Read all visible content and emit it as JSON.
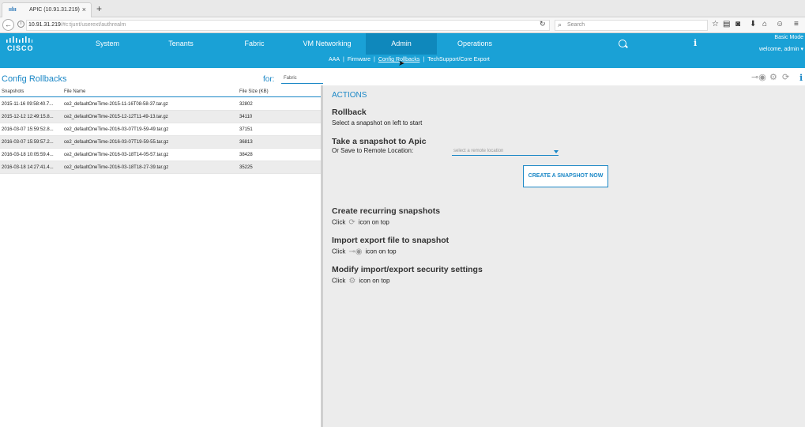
{
  "browser": {
    "tab_favicon": "ıılıı",
    "tab_title": "APIC (10.91.31.219)",
    "tab_close": "×",
    "new_tab": "+",
    "url_host": "10.91.31.219",
    "url_path": "/#c:tjunt/userext/authrealm",
    "search_placeholder": "Search"
  },
  "header": {
    "logo_text": "CISCO",
    "menu": [
      "System",
      "Tenants",
      "Fabric",
      "VM Networking",
      "Admin",
      "Operations"
    ],
    "active_menu": "Admin",
    "mode": "Basic Mode",
    "welcome": "welcome, admin ▾",
    "subnav": [
      "AAA",
      "Firmware",
      "Config Rollbacks",
      "TechSupport/Core Export"
    ],
    "active_subnav": "Config Rollbacks"
  },
  "left": {
    "title": "Config Rollbacks",
    "for_label": "for:",
    "for_value": "Fabric",
    "columns": [
      "Snapshots",
      "File Name",
      "File Size (KB)"
    ],
    "rows": [
      {
        "snapshot": "2015-11-16 09:58:40.7...",
        "file": "ce2_defaultOneTime-2015-11-16T08-58-37.tar.gz",
        "size": "32802"
      },
      {
        "snapshot": "2015-12-12 12:49:15.8...",
        "file": "ce2_defaultOneTime-2015-12-12T11-49-13.tar.gz",
        "size": "34110"
      },
      {
        "snapshot": "2016-03-07 15:59:52.8...",
        "file": "ce2_defaultOneTime-2016-03-07T19-59-49.tar.gz",
        "size": "37151"
      },
      {
        "snapshot": "2016-03-07 15:59:57.2...",
        "file": "ce2_defaultOneTime-2016-03-07T19-59-55.tar.gz",
        "size": "36813"
      },
      {
        "snapshot": "2016-03-18 10:05:59.4...",
        "file": "ce2_defaultOneTime-2016-03-18T14-05-57.tar.gz",
        "size": "38428"
      },
      {
        "snapshot": "2016-03-18 14:27:41.4...",
        "file": "ce2_defaultOneTime-2016-03-18T18-27-39.tar.gz",
        "size": "35225"
      }
    ]
  },
  "right": {
    "actions_title": "ACTIONS",
    "rollback_title": "Rollback",
    "rollback_text": "Select a snapshot on left to start",
    "snapshot_title": "Take a snapshot to Apic",
    "snapshot_text": "Or Save to Remote Location:",
    "remote_placeholder": "select a remote location",
    "snapshot_button": "CREATE A SNAPSHOT NOW",
    "recurring_title": "Create recurring snapshots",
    "import_title": "Import export file to snapshot",
    "security_title": "Modify import/export security settings",
    "click_label": "Click",
    "icon_suffix": "icon on top"
  }
}
